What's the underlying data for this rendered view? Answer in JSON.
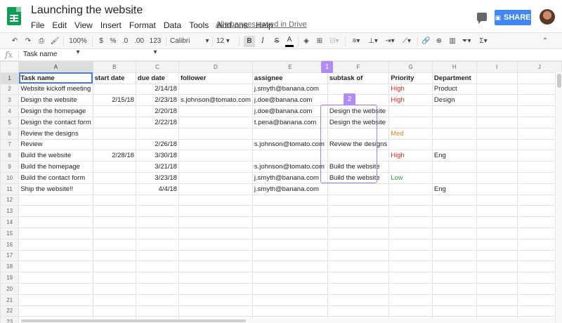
{
  "doc": {
    "title": "Launching the website",
    "saved_status": "All changes saved in Drive"
  },
  "menu": [
    "File",
    "Edit",
    "View",
    "Insert",
    "Format",
    "Data",
    "Tools",
    "Add-ons",
    "Help"
  ],
  "share_label": "SHARE",
  "toolbar": {
    "zoom": "100%",
    "currency": "$",
    "percent": "%",
    "dec_less": ".0",
    "dec_more": ".00",
    "more_formats": "123",
    "font": "Calibri",
    "font_size": "12",
    "bold": "B",
    "italic": "I",
    "strike": "S",
    "text_color": "A"
  },
  "formula_bar": {
    "fx": "fx",
    "value": "Task name"
  },
  "columns": [
    "A",
    "B",
    "C",
    "D",
    "E",
    "F",
    "G",
    "H",
    "I",
    "J"
  ],
  "rows": [
    [
      "Task name",
      "start date",
      "due date",
      "follower",
      "assignee",
      "subtask of",
      "Priority",
      "Department",
      "",
      ""
    ],
    [
      "Website kickoff meeting",
      "",
      "2/14/18",
      "",
      "j.smyth@banana.com",
      "",
      "High",
      "Product",
      "",
      ""
    ],
    [
      "Design the website",
      "2/15/18",
      "2/23/18",
      "s.johnson@tomato.com",
      "j.doe@banana.com",
      "",
      "High",
      "Design",
      "",
      ""
    ],
    [
      "Design the homepage",
      "",
      "2/20/18",
      "",
      "j.doe@banana.com",
      "Design the website",
      "",
      "",
      "",
      ""
    ],
    [
      "Design the contact form",
      "",
      "2/22/18",
      "",
      "t.pena@banana.com",
      "Design the website",
      "",
      "",
      "",
      ""
    ],
    [
      "Review the designs",
      "",
      "",
      "",
      "",
      "",
      "Med",
      "",
      "",
      ""
    ],
    [
      "Review",
      "",
      "2/26/18",
      "",
      "s.johnson@tomato.com",
      "Review the designs",
      "",
      "",
      "",
      ""
    ],
    [
      "Build the website",
      "2/28/18",
      "3/30/18",
      "",
      "",
      "",
      "High",
      "Eng",
      "",
      ""
    ],
    [
      "Build the homepage",
      "",
      "3/21/18",
      "",
      "s.johnson@tomato.com",
      "Build the website",
      "",
      "",
      "",
      ""
    ],
    [
      "Build the contact form",
      "",
      "3/23/18",
      "",
      "j.smyth@banana.com",
      "Build the website",
      "Low",
      "",
      "",
      ""
    ],
    [
      "Ship the website!!",
      "",
      "4/4/18",
      "",
      "j.smyth@banana.com",
      "",
      "",
      "Eng",
      "",
      ""
    ]
  ],
  "total_rows": 23,
  "callouts": [
    {
      "label": "1"
    },
    {
      "label": "2"
    }
  ],
  "colors": {
    "high": "#e8281e",
    "med": "#e38526",
    "low": "#2f9d42",
    "callout": "#b08cf5",
    "share": "#4285f4",
    "sheets_green": "#0f9d58"
  }
}
